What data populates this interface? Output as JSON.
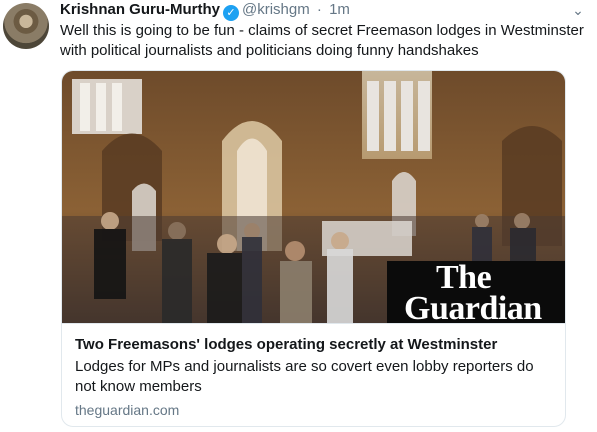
{
  "tweet": {
    "author_name": "Krishnan Guru-Murthy",
    "handle": "@krishgm",
    "separator": "·",
    "time": "1m",
    "text": "Well this is going to be fun - claims of secret Freemason lodges in Westminster with political journalists and politicians doing funny handshakes",
    "verified_icon": "verified-badge-icon",
    "menu_icon": "chevron-down-icon"
  },
  "card": {
    "brand_line1": "The",
    "brand_line2": "Guardian",
    "title": "Two Freemasons' lodges operating secretly at Westminster",
    "description": "Lodges for MPs and journalists are so covert even lobby reporters do not know members",
    "domain": "theguardian.com"
  },
  "colors": {
    "accent": "#1da1f2",
    "text": "#14171a",
    "secondary": "#657786",
    "border": "#e1e8ed"
  }
}
